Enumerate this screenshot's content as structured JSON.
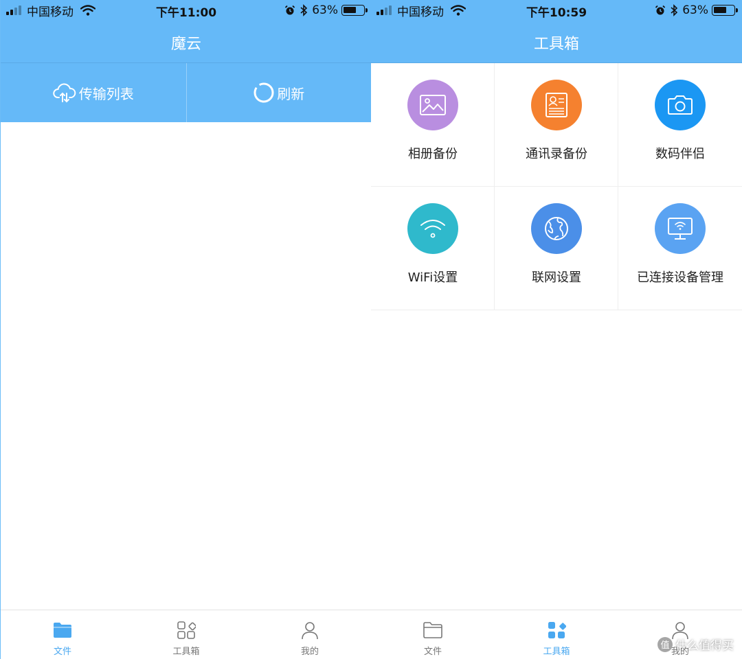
{
  "colors": {
    "header_blue": "#65b9f8",
    "tab_active": "#4aa8f0",
    "tab_inactive": "#777777",
    "album_purple": "#b98ee0",
    "contacts_orange": "#f5812f",
    "camera_blue": "#1b97f3",
    "wifi_teal": "#2fb9cc",
    "network_blue": "#4b8fe8",
    "device_blue": "#5aa3f2"
  },
  "left_screen": {
    "statusbar": {
      "carrier": "中国移动",
      "time": "下午11:00",
      "battery": "63%"
    },
    "title": "魔云",
    "actions": [
      {
        "label": "传输列表",
        "icon": "cloud-upload-icon"
      },
      {
        "label": "刷新",
        "icon": "refresh-icon"
      }
    ],
    "tabs": [
      {
        "label": "文件",
        "icon": "folder-icon",
        "active": true
      },
      {
        "label": "工具箱",
        "icon": "toolbox-icon",
        "active": false
      },
      {
        "label": "我的",
        "icon": "person-icon",
        "active": false
      }
    ]
  },
  "right_screen": {
    "statusbar": {
      "carrier": "中国移动",
      "time": "下午10:59",
      "battery": "63%"
    },
    "title": "工具箱",
    "tools": [
      {
        "label": "相册备份",
        "icon": "photo-icon"
      },
      {
        "label": "通讯录备份",
        "icon": "contacts-icon"
      },
      {
        "label": "数码伴侣",
        "icon": "camera-icon"
      },
      {
        "label": "WiFi设置",
        "icon": "wifi-icon"
      },
      {
        "label": "联网设置",
        "icon": "globe-icon"
      },
      {
        "label": "已连接设备管理",
        "icon": "monitor-icon"
      }
    ],
    "tabs": [
      {
        "label": "文件",
        "icon": "folder-icon",
        "active": false
      },
      {
        "label": "工具箱",
        "icon": "toolbox-icon",
        "active": true
      },
      {
        "label": "我的",
        "icon": "person-icon",
        "active": false
      }
    ]
  },
  "watermark": {
    "badge": "值",
    "text": "什么值得买"
  }
}
